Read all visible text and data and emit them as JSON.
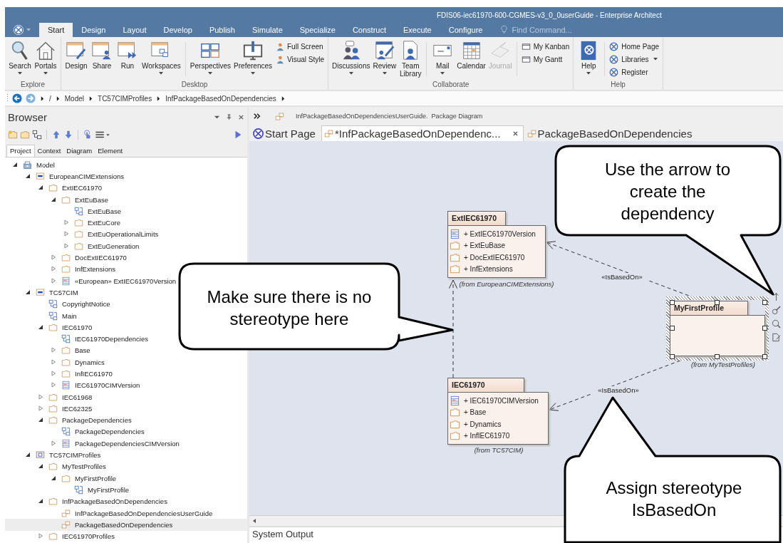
{
  "window": {
    "title": "FDIS06-iec61970-600-CGMES-v3_0_0userGuide - Enterprise Architect"
  },
  "ribbon": {
    "tabs": [
      {
        "label": "Start",
        "selected": true
      },
      {
        "label": "Design",
        "selected": false
      },
      {
        "label": "Layout",
        "selected": false
      },
      {
        "label": "Develop",
        "selected": false
      },
      {
        "label": "Publish",
        "selected": false
      },
      {
        "label": "Simulate",
        "selected": false
      },
      {
        "label": "Specialize",
        "selected": false
      },
      {
        "label": "Construct",
        "selected": false
      },
      {
        "label": "Execute",
        "selected": false
      },
      {
        "label": "Configure",
        "selected": false
      }
    ],
    "find": {
      "placeholder": "Find Command..."
    },
    "groups": [
      {
        "label": "Explore",
        "sets": [
          [
            {
              "kind": "large",
              "label": "Search",
              "dropdown": true,
              "disabled": false
            },
            {
              "kind": "large",
              "label": "Portals",
              "dropdown": true,
              "disabled": false
            }
          ]
        ]
      },
      {
        "label": "Desktop",
        "sets": [
          [
            {
              "kind": "large",
              "label": "Design",
              "dropdown": false,
              "disabled": false
            },
            {
              "kind": "large",
              "label": "Share",
              "dropdown": false,
              "disabled": false
            },
            {
              "kind": "large",
              "label": "Run",
              "dropdown": false,
              "disabled": false
            },
            {
              "kind": "large",
              "label": "Workspaces",
              "dropdown": true,
              "disabled": false
            }
          ],
          [
            {
              "kind": "large",
              "label": "Perspectives",
              "dropdown": true,
              "disabled": false
            },
            {
              "kind": "large",
              "label": "Preferences",
              "dropdown": true,
              "disabled": false
            },
            {
              "kind": "small",
              "label": "Full Screen",
              "dropdown": false,
              "disabled": false
            },
            {
              "kind": "small",
              "label": "Visual Style",
              "dropdown": false,
              "disabled": false
            }
          ]
        ]
      },
      {
        "label": "Collaborate",
        "sets": [
          [
            {
              "kind": "large",
              "label": "Discussions",
              "dropdown": true,
              "disabled": false
            },
            {
              "kind": "large",
              "label": "Review",
              "dropdown": true,
              "disabled": false
            },
            {
              "kind": "large",
              "label": "Team Library",
              "dropdown": false,
              "disabled": false
            }
          ],
          [
            {
              "kind": "large",
              "label": "Mail",
              "dropdown": true,
              "disabled": false
            },
            {
              "kind": "large",
              "label": "Calendar",
              "dropdown": false,
              "disabled": false
            },
            {
              "kind": "large",
              "label": "Journal",
              "dropdown": false,
              "disabled": true
            }
          ],
          [
            {
              "kind": "small",
              "label": "My Kanban",
              "dropdown": false,
              "disabled": false
            },
            {
              "kind": "small",
              "label": "My Gantt",
              "dropdown": false,
              "disabled": false
            }
          ]
        ]
      },
      {
        "label": "Help",
        "sets": [
          [
            {
              "kind": "large",
              "label": "Help",
              "dropdown": true,
              "disabled": false
            }
          ],
          [
            {
              "kind": "small",
              "label": "Home Page",
              "dropdown": false,
              "disabled": false
            },
            {
              "kind": "small",
              "label": "Libraries",
              "dropdown": true,
              "disabled": false
            },
            {
              "kind": "small",
              "label": "Register",
              "dropdown": false,
              "disabled": false
            }
          ]
        ]
      }
    ]
  },
  "breadcrumb": [
    "/",
    "Model",
    "TC57CIMProfiles",
    "InfPackageBasedOnDependencies"
  ],
  "browser": {
    "title": "Browser",
    "tabs": [
      {
        "label": "Project",
        "selected": true
      },
      {
        "label": "Context",
        "selected": false
      },
      {
        "label": "Diagram",
        "selected": false
      },
      {
        "label": "Element",
        "selected": false
      }
    ],
    "tree": [
      {
        "label": "Model",
        "kind": "model",
        "selected": false,
        "expanded": true,
        "children": [
          {
            "label": "EuropeanCIMExtensions",
            "kind": "namespace",
            "selected": false,
            "expanded": true,
            "children": [
              {
                "label": "ExtIEC61970",
                "kind": "folder",
                "selected": false,
                "expanded": true,
                "children": [
                  {
                    "label": "ExtEuBase",
                    "kind": "folder",
                    "selected": false,
                    "expanded": true,
                    "children": [
                      {
                        "label": "ExtEuBase",
                        "kind": "diagram",
                        "selected": false
                      },
                      {
                        "label": "ExtEuCore",
                        "kind": "folder",
                        "selected": false,
                        "expanded": false
                      },
                      {
                        "label": "ExtEuOperationalLimits",
                        "kind": "folder",
                        "selected": false,
                        "expanded": false
                      },
                      {
                        "label": "ExtEuGeneration",
                        "kind": "folder",
                        "selected": false,
                        "expanded": false
                      }
                    ]
                  },
                  {
                    "label": "DocExtIEC61970",
                    "kind": "folder",
                    "selected": false,
                    "expanded": false
                  },
                  {
                    "label": "InfExtensions",
                    "kind": "folder",
                    "selected": false,
                    "expanded": false
                  },
                  {
                    "label": "«European» ExtIEC61970Version",
                    "kind": "version",
                    "selected": false,
                    "expanded": false
                  }
                ]
              }
            ]
          },
          {
            "label": "TC57CIM",
            "kind": "namespace",
            "selected": false,
            "expanded": true,
            "children": [
              {
                "label": "CopyrightNotice",
                "kind": "diagram",
                "selected": false
              },
              {
                "label": "Main",
                "kind": "diagram",
                "selected": false
              },
              {
                "label": "IEC61970",
                "kind": "folder",
                "selected": false,
                "expanded": true,
                "children": [
                  {
                    "label": "IEC61970Dependencies",
                    "kind": "diagram",
                    "selected": false
                  },
                  {
                    "label": "Base",
                    "kind": "folder",
                    "selected": false,
                    "expanded": false
                  },
                  {
                    "label": "Dynamics",
                    "kind": "folder",
                    "selected": false,
                    "expanded": false
                  },
                  {
                    "label": "InfIEC61970",
                    "kind": "folder",
                    "selected": false,
                    "expanded": false
                  },
                  {
                    "label": "IEC61970CIMVersion",
                    "kind": "version",
                    "selected": false,
                    "expanded": false
                  }
                ]
              },
              {
                "label": "IEC61968",
                "kind": "folder",
                "selected": false,
                "expanded": false
              },
              {
                "label": "IEC62325",
                "kind": "folder",
                "selected": false,
                "expanded": false
              },
              {
                "label": "PackageDependencies",
                "kind": "folder",
                "selected": false,
                "expanded": true,
                "children": [
                  {
                    "label": "PackageDependencies",
                    "kind": "diagram",
                    "selected": false
                  },
                  {
                    "label": "PackageDependenciesCIMVersion",
                    "kind": "version",
                    "selected": false,
                    "expanded": false
                  }
                ]
              }
            ]
          },
          {
            "label": "TC57CIMProfiles",
            "kind": "view",
            "selected": false,
            "expanded": true,
            "children": [
              {
                "label": "MyTestProfiles",
                "kind": "folder",
                "selected": false,
                "expanded": true,
                "children": [
                  {
                    "label": "MyFirstProfile",
                    "kind": "folder",
                    "selected": false,
                    "expanded": true,
                    "children": [
                      {
                        "label": "MyFirstProfile",
                        "kind": "diagram",
                        "selected": false
                      }
                    ]
                  }
                ]
              },
              {
                "label": "InfPackageBasedOnDependencies",
                "kind": "folder",
                "selected": false,
                "expanded": true,
                "children": [
                  {
                    "label": "InfPackageBasedOnDependenciesUserGuide",
                    "kind": "package-diagram",
                    "selected": false
                  },
                  {
                    "label": "PackageBasedOnDependencies",
                    "kind": "package-diagram",
                    "selected": true
                  }
                ]
              },
              {
                "label": "IEC61970Profiles",
                "kind": "folder",
                "selected": false,
                "expanded": false
              }
            ]
          }
        ]
      }
    ]
  },
  "diagram": {
    "header": "InfPackageBasedOnDependenciesUserGuide.  Package Diagram",
    "tabs": [
      {
        "label": "Start Page",
        "selected": false,
        "closable": false
      },
      {
        "label": "*InfPackageBasedOnDependenc...",
        "selected": true,
        "closable": true
      },
      {
        "label": "PackageBasedOnDependencies",
        "selected": false,
        "closable": false
      }
    ],
    "packages": [
      {
        "name": "ExtIEC61970",
        "selected": false,
        "from": "(from EuropeanCIMExtensions)",
        "items": [
          {
            "kind": "version",
            "label": "+ ExtIEC61970Version"
          },
          {
            "kind": "folder",
            "label": "+ ExtEuBase"
          },
          {
            "kind": "folder",
            "label": "+ DocExtIEC61970"
          },
          {
            "kind": "folder",
            "label": "+ InfExtensions"
          }
        ]
      },
      {
        "name": "IEC61970",
        "selected": false,
        "from": "(from TC57CIM)",
        "items": [
          {
            "kind": "version",
            "label": "+ IEC61970CIMVersion"
          },
          {
            "kind": "folder",
            "label": "+ Base"
          },
          {
            "kind": "folder",
            "label": "+ Dynamics"
          },
          {
            "kind": "folder",
            "label": "+ InfIEC61970"
          }
        ]
      },
      {
        "name": "MyFirstProfile",
        "selected": true,
        "from": "(from MyTestProfiles)"
      }
    ],
    "connectors": [
      {
        "stereotype": "«IsBasedOn»"
      },
      {
        "stereotype": "«IsBasedOn»"
      }
    ]
  },
  "output": {
    "title": "System Output"
  },
  "callouts": [
    {
      "text": "Use the arrow to create the dependency"
    },
    {
      "text": "Make sure there is no stereotype here"
    },
    {
      "text": "Assign stereotype IsBasedOn"
    }
  ]
}
